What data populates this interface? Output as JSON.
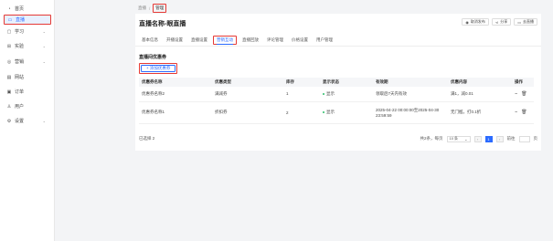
{
  "sidebar": {
    "items": [
      {
        "label": "首页",
        "icon": "dashboard-icon",
        "glyph": "◔",
        "chev": ""
      },
      {
        "label": "直播",
        "icon": "live-icon",
        "glyph": "▭",
        "chev": "",
        "active": true
      },
      {
        "label": "学习",
        "icon": "book-icon",
        "glyph": "▢",
        "chev": "⌄"
      },
      {
        "label": "实验",
        "icon": "flask-icon",
        "glyph": "⊞",
        "chev": "⌄"
      },
      {
        "label": "营销",
        "icon": "marketing-icon",
        "glyph": "◎",
        "chev": "⌄"
      },
      {
        "label": "网站",
        "icon": "website-icon",
        "glyph": "▤",
        "chev": ""
      },
      {
        "label": "订单",
        "icon": "order-icon",
        "glyph": "▣",
        "chev": ""
      },
      {
        "label": "用户",
        "icon": "user-icon",
        "glyph": "♙",
        "chev": ""
      },
      {
        "label": "设置",
        "icon": "settings-icon",
        "glyph": "⚙",
        "chev": "⌄"
      }
    ]
  },
  "breadcrumb": {
    "parent": "直播",
    "sep": "/",
    "current": "管理"
  },
  "page": {
    "title": "直播名称-眼直播"
  },
  "header_buttons": [
    {
      "label": "取消发布",
      "icon": "unpublish-icon",
      "glyph": "◉"
    },
    {
      "label": "分享",
      "icon": "share-icon",
      "glyph": "⋖"
    },
    {
      "label": "去直播",
      "icon": "go-live-icon",
      "glyph": "▭"
    }
  ],
  "tabs": [
    {
      "label": "基本信息"
    },
    {
      "label": "开播设置"
    },
    {
      "label": "直播设置"
    },
    {
      "label": "营销互动",
      "active": true
    },
    {
      "label": "直播回放"
    },
    {
      "label": "评论管理"
    },
    {
      "label": "价格设置"
    },
    {
      "label": "用户管理"
    }
  ],
  "section": {
    "title": "直播间优惠券",
    "add_button": "+ 添加优惠券"
  },
  "table": {
    "columns": [
      "优惠券名称",
      "优惠类型",
      "库存",
      "显示状态",
      "有效期",
      "优惠内容",
      "操作"
    ],
    "rows": [
      {
        "name": "优惠券名称2",
        "type": "满减券",
        "stock": "1",
        "status": "显示",
        "validity": "领取后7天内有效",
        "content": "满1，减0.01"
      },
      {
        "name": "优惠券名称1",
        "type": "折扣券",
        "stock": "2",
        "status": "显示",
        "validity": "2025-04-22 00:00:00至2025-04-30 23:59:59",
        "content": "无门槛，打0.1折"
      }
    ]
  },
  "footer": {
    "selected": "已选择 2",
    "total": "共2条，每页",
    "page_size": "10 条",
    "prev": "‹",
    "page": "1",
    "next": "›",
    "jump_label": "前往",
    "jump_unit": "页"
  },
  "colors": {
    "accent": "#2b6bff",
    "highlight": "#e53935",
    "status_green": "#2bbf6a"
  }
}
